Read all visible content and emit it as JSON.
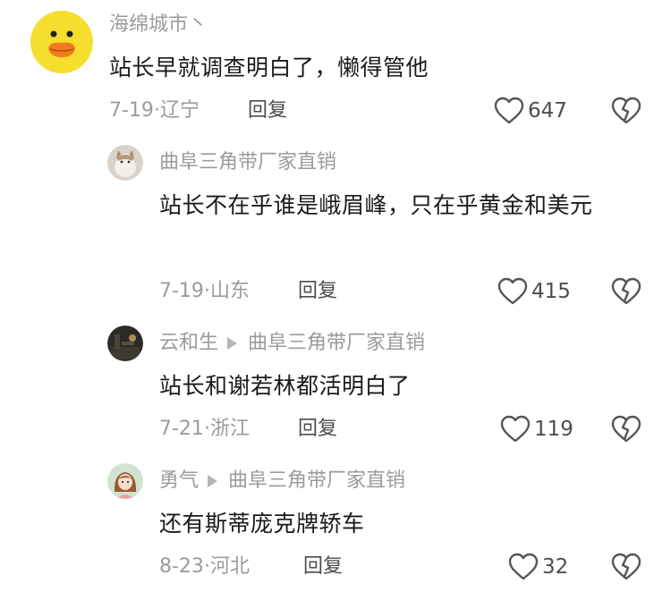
{
  "comments": [
    {
      "username": "海绵城市丶",
      "text": "站长早就调查明白了，懒得管他",
      "date": "7-19",
      "location": "辽宁",
      "reply_label": "回复",
      "likes": "647",
      "avatar_icon": "duck-avatar-icon"
    },
    {
      "username": "曲阜三角带厂家直销",
      "text": "站长不在乎谁是峨眉峰，只在乎黄金和美元",
      "date": "7-19",
      "location": "山东",
      "reply_label": "回复",
      "likes": "415",
      "avatar_icon": "cat-avatar-icon"
    },
    {
      "username": "云和生",
      "reply_to": "曲阜三角带厂家直销",
      "text": "站长和谢若林都活明白了",
      "date": "7-21",
      "location": "浙江",
      "reply_label": "回复",
      "likes": "119",
      "avatar_icon": "dark-photo-avatar-icon"
    },
    {
      "username": "勇气",
      "reply_to": "曲阜三角带厂家直销",
      "text": "还有斯蒂庞克牌轿车",
      "date": "8-23",
      "location": "河北",
      "reply_label": "回复",
      "likes": "32",
      "avatar_icon": "girl-avatar-icon"
    }
  ],
  "meta_separator": "·",
  "colors": {
    "username": "#9b9b9b",
    "text": "#1a1a1a",
    "reply": "#4d4d4d",
    "icon_stroke": "#555555"
  }
}
